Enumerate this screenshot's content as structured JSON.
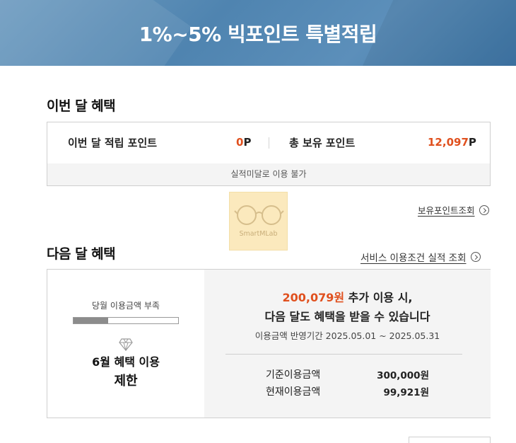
{
  "banner": {
    "title": "1%~5% 빅포인트 특별적립"
  },
  "this_month": {
    "title": "이번 달 혜택",
    "earned_label": "이번 달 적립 포인트",
    "earned_value": "0",
    "earned_unit": "P",
    "total_label": "총 보유 포인트",
    "total_value": "12,097",
    "total_unit": "P",
    "footnote": "실적미달로 이용 불가",
    "points_link": "보유포인트조회"
  },
  "watermark": {
    "text": "SmartMLab"
  },
  "next_month": {
    "title": "다음 달 혜택",
    "service_link": "서비스 이용조건 실적 조회",
    "usage_label": "당월 이용금액 부족",
    "usage_progress_fraction": 0.333,
    "limit_line1": "6월 혜택 이용",
    "limit_line2": "제한",
    "needed_amount": "200,079원",
    "needed_suffix": " 추가 이용 시,",
    "benefit_line": "다음 달도 혜택을 받을 수 있습니다",
    "period": "이용금액 반영기간 2025.05.01 ~ 2025.05.31",
    "base_label": "기준이용금액",
    "base_value": "300,000원",
    "current_label": "현재이용금액",
    "current_value": "99,921원"
  },
  "icons": {
    "chevron": "chevron-right-circle-icon",
    "diamond": "diamond-icon",
    "glasses": "glasses-logo"
  },
  "colors": {
    "accent": "#e0501e",
    "banner": "#4f84b0"
  }
}
